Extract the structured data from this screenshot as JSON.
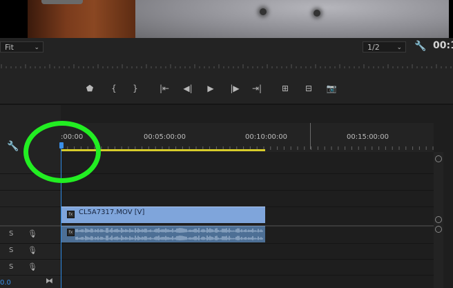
{
  "monitor": {
    "fit_label": "Fit",
    "resolution_label": "1/2",
    "timecode": "00:1"
  },
  "transport": {
    "buttons": [
      {
        "name": "add-marker-button",
        "glyph": "⬟"
      },
      {
        "name": "mark-in-button",
        "glyph": "{"
      },
      {
        "name": "mark-out-button",
        "glyph": "}"
      },
      {
        "name": "go-to-in-button",
        "glyph": "|⇤"
      },
      {
        "name": "step-back-button",
        "glyph": "◀|"
      },
      {
        "name": "play-button",
        "glyph": "▶"
      },
      {
        "name": "step-forward-button",
        "glyph": "|▶"
      },
      {
        "name": "go-to-out-button",
        "glyph": "⇥|"
      },
      {
        "name": "insert-button",
        "glyph": "⊞"
      },
      {
        "name": "overwrite-button",
        "glyph": "⊟"
      },
      {
        "name": "export-frame-button",
        "glyph": "📷"
      }
    ]
  },
  "timeline": {
    "tick_labels": [
      ":00:00",
      "00:05:00:00",
      "00:10:00:00",
      "00:15:00:00"
    ],
    "video_clip_name": "CL5A7317.MOV [V]",
    "fx_badge": "fx",
    "audio_tracks": [
      {
        "solo": "S"
      },
      {
        "solo": "S"
      },
      {
        "solo": "S"
      }
    ],
    "master_value": "0.0"
  },
  "colors": {
    "highlight": "#22ee22",
    "playhead": "#2e8ce6",
    "video_clip": "#7fa5db",
    "audio_clip": "#4d6f95",
    "work_area": "#d7cc2a"
  }
}
